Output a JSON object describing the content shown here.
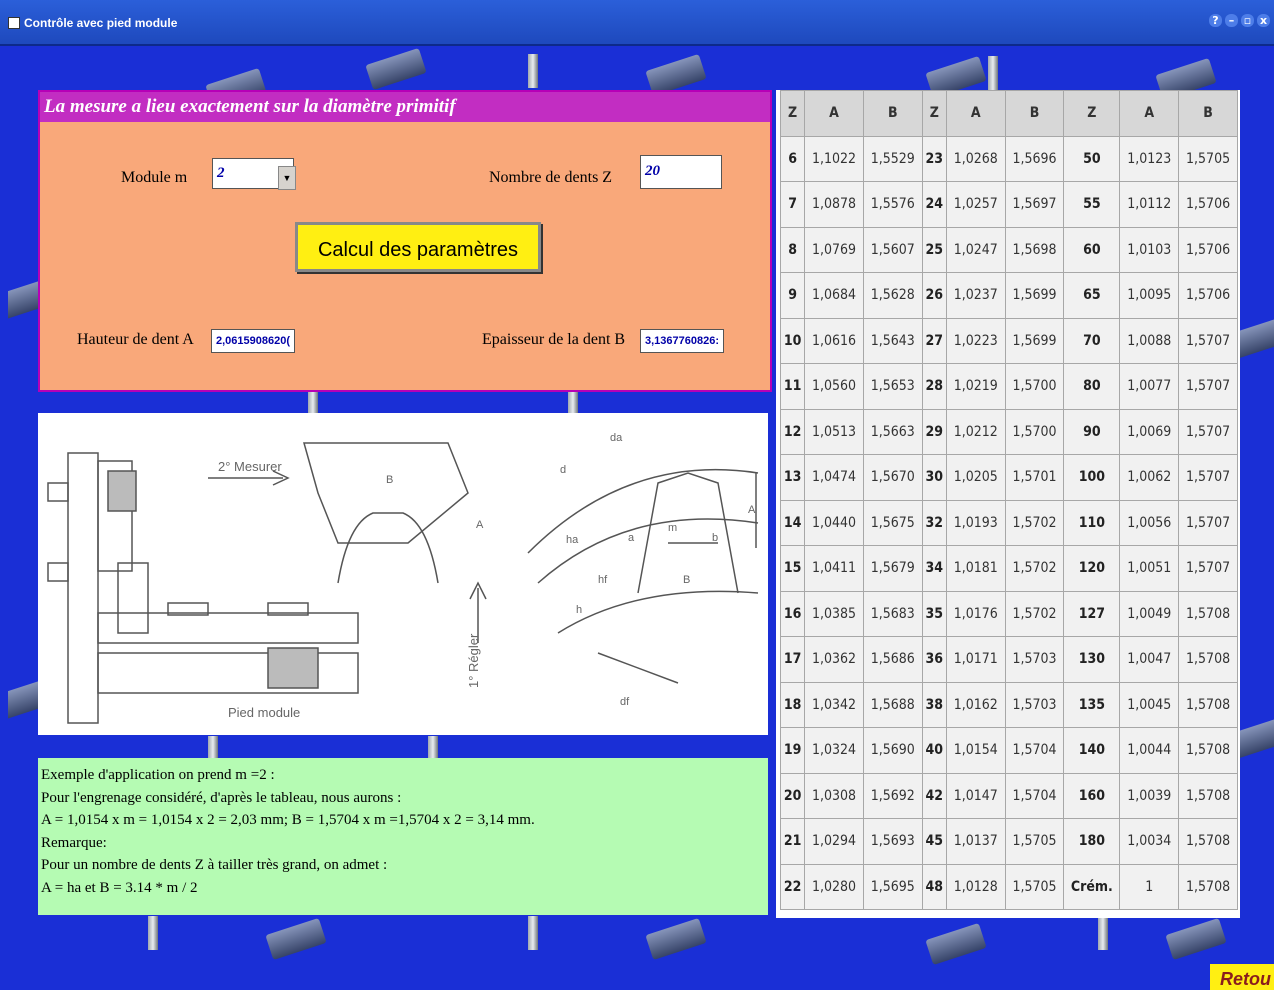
{
  "window": {
    "title": "Contrôle  avec pied module",
    "controls": [
      "?",
      "–",
      "▫",
      "x"
    ]
  },
  "panel": {
    "header": "La mesure a lieu exactement sur la diamètre primitif",
    "module_label": "Module m",
    "module_value": "2",
    "teeth_label": "Nombre de dents Z",
    "teeth_value": "20",
    "calc_button": "Calcul des paramètres",
    "height_label": "Hauteur de dent  A",
    "height_value": "2,0615908620(",
    "thickness_label": "Epaisseur de la dent B",
    "thickness_value": "3,1367760826:"
  },
  "diagram": {
    "measure_label": "2° Mesurer",
    "adjust_label": "1° Régler",
    "caliper_label": "Pied module",
    "labels": {
      "B": "B",
      "A": "A",
      "da": "da",
      "d": "d",
      "df": "df",
      "m": "m",
      "a": "a",
      "b": "b",
      "h": "h",
      "ha": "ha",
      "hf": "hf"
    }
  },
  "example": {
    "lines": [
      "Exemple d'application on prend m =2 :",
      "Pour l'engrenage considéré, d'après le tableau, nous aurons :",
      "A = 1,0154 x m = 1,0154 x 2 = 2,03 mm; B = 1,5704 x m =1,5704 x 2 = 3,14 mm.",
      "Remarque:",
      "Pour un nombre de dents Z à tailler très grand, on admet :",
      "A = ha et B = 3.14 * m / 2"
    ]
  },
  "table": {
    "headers": [
      "Z",
      "A",
      "B",
      "Z",
      "A",
      "B",
      "Z",
      "A",
      "B"
    ],
    "rows": [
      [
        "6",
        "1,1022",
        "1,5529",
        "23",
        "1,0268",
        "1,5696",
        "50",
        "1,0123",
        "1,5705"
      ],
      [
        "7",
        "1,0878",
        "1,5576",
        "24",
        "1,0257",
        "1,5697",
        "55",
        "1,0112",
        "1,5706"
      ],
      [
        "8",
        "1,0769",
        "1,5607",
        "25",
        "1,0247",
        "1,5698",
        "60",
        "1,0103",
        "1,5706"
      ],
      [
        "9",
        "1,0684",
        "1,5628",
        "26",
        "1,0237",
        "1,5699",
        "65",
        "1,0095",
        "1,5706"
      ],
      [
        "10",
        "1,0616",
        "1,5643",
        "27",
        "1,0223",
        "1,5699",
        "70",
        "1,0088",
        "1,5707"
      ],
      [
        "11",
        "1,0560",
        "1,5653",
        "28",
        "1,0219",
        "1,5700",
        "80",
        "1,0077",
        "1,5707"
      ],
      [
        "12",
        "1,0513",
        "1,5663",
        "29",
        "1,0212",
        "1,5700",
        "90",
        "1,0069",
        "1,5707"
      ],
      [
        "13",
        "1,0474",
        "1,5670",
        "30",
        "1,0205",
        "1,5701",
        "100",
        "1,0062",
        "1,5707"
      ],
      [
        "14",
        "1,0440",
        "1,5675",
        "32",
        "1,0193",
        "1,5702",
        "110",
        "1,0056",
        "1,5707"
      ],
      [
        "15",
        "1,0411",
        "1,5679",
        "34",
        "1,0181",
        "1,5702",
        "120",
        "1,0051",
        "1,5707"
      ],
      [
        "16",
        "1,0385",
        "1,5683",
        "35",
        "1,0176",
        "1,5702",
        "127",
        "1,0049",
        "1,5708"
      ],
      [
        "17",
        "1,0362",
        "1,5686",
        "36",
        "1,0171",
        "1,5703",
        "130",
        "1,0047",
        "1,5708"
      ],
      [
        "18",
        "1,0342",
        "1,5688",
        "38",
        "1,0162",
        "1,5703",
        "135",
        "1,0045",
        "1,5708"
      ],
      [
        "19",
        "1,0324",
        "1,5690",
        "40",
        "1,0154",
        "1,5704",
        "140",
        "1,0044",
        "1,5708"
      ],
      [
        "20",
        "1,0308",
        "1,5692",
        "42",
        "1,0147",
        "1,5704",
        "160",
        "1,0039",
        "1,5708"
      ],
      [
        "21",
        "1,0294",
        "1,5693",
        "45",
        "1,0137",
        "1,5705",
        "180",
        "1,0034",
        "1,5708"
      ],
      [
        "22",
        "1,0280",
        "1,5695",
        "48",
        "1,0128",
        "1,5705",
        "Crém.",
        "1",
        "1,5708"
      ]
    ]
  },
  "retour": "Retou",
  "colors": {
    "background": "#1a2fd6",
    "panel": "#f9a87a",
    "header": "#c22dc2",
    "button": "#ffef12",
    "example": "#b5fbb3"
  }
}
